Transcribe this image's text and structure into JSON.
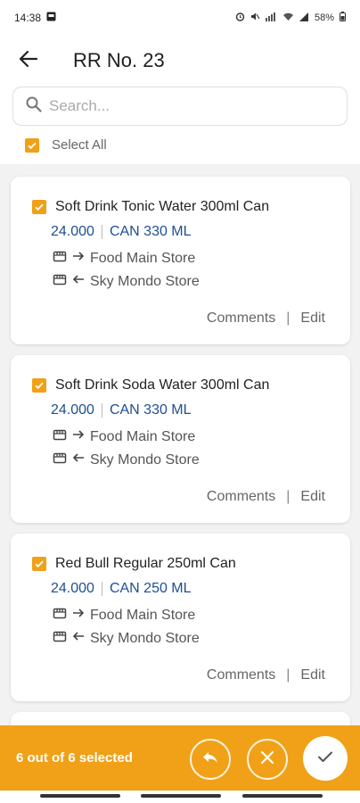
{
  "status_bar": {
    "time": "14:38",
    "battery": "58%"
  },
  "header": {
    "title": "RR No. 23"
  },
  "search": {
    "placeholder": "Search..."
  },
  "select_all": {
    "label": "Select All",
    "checked": true
  },
  "items": [
    {
      "name": "Soft Drink Tonic Water 300ml Can",
      "quantity": "24.000",
      "unit": "CAN 330 ML",
      "from_store": "Food Main Store",
      "to_store": "Sky Mondo Store",
      "comments_label": "Comments",
      "edit_label": "Edit",
      "checked": true
    },
    {
      "name": "Soft Drink Soda Water 300ml Can",
      "quantity": "24.000",
      "unit": "CAN 330 ML",
      "from_store": "Food Main Store",
      "to_store": "Sky Mondo Store",
      "comments_label": "Comments",
      "edit_label": "Edit",
      "checked": true
    },
    {
      "name": "Red Bull Regular 250ml Can",
      "quantity": "24.000",
      "unit": "CAN 250 ML",
      "from_store": "Food Main Store",
      "to_store": "Sky Mondo Store",
      "comments_label": "Comments",
      "edit_label": "Edit",
      "checked": true
    }
  ],
  "footer": {
    "selected_text": "6 out of 6 selected",
    "buttons": [
      "reply-icon",
      "close-icon",
      "check-icon"
    ]
  },
  "colors": {
    "accent": "#f0a117",
    "quantity_blue": "#1e4f93",
    "background": "#f2f2f2"
  }
}
